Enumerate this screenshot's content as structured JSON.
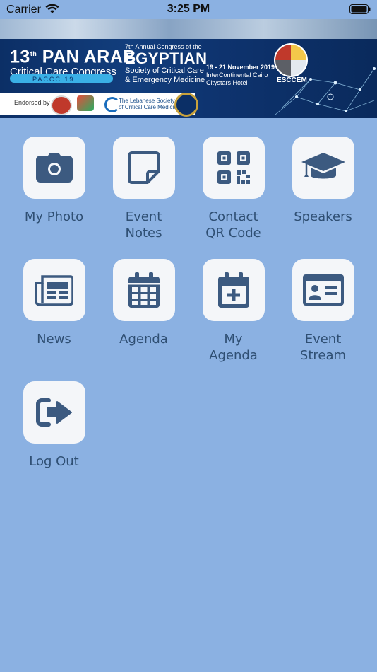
{
  "status": {
    "carrier": "Carrier",
    "time": "3:25 PM"
  },
  "banner": {
    "pan_number": "13",
    "pan_superscript": "th",
    "pan_title": "PAN ARAB",
    "pan_subtitle": "Critical Care Congress",
    "pacc": "PACCC 19",
    "egy_small": "7th Annual Congress of the",
    "egy_title": "EGYPTIAN",
    "egy_line1": "Society of Critical Care",
    "egy_line2": "& Emergency Medicine",
    "date": "19 - 21 November 2019",
    "venue1": "InterContinental Cairo",
    "venue2": "Citystars Hotel",
    "esccem": "ESCCEM",
    "endorsed": "Endorsed by",
    "lebanese1": "The Lebanese Society",
    "lebanese2": "of Critical Care Medicine"
  },
  "menu": [
    {
      "label": "My Photo",
      "icon": "camera-icon"
    },
    {
      "label": "Event\nNotes",
      "icon": "sticky-note-icon"
    },
    {
      "label": "Contact\nQR Code",
      "icon": "qr-code-icon"
    },
    {
      "label": "Speakers",
      "icon": "graduation-cap-icon"
    },
    {
      "label": "News",
      "icon": "newspaper-icon"
    },
    {
      "label": "Agenda",
      "icon": "calendar-icon"
    },
    {
      "label": "My\nAgenda",
      "icon": "calendar-plus-icon"
    },
    {
      "label": "Event\nStream",
      "icon": "id-card-icon"
    },
    {
      "label": "Log Out",
      "icon": "sign-out-icon"
    }
  ],
  "colors": {
    "background": "#8bb1e2",
    "tile": "#f4f6f9",
    "icon": "#3c5a80",
    "label": "#2f4f73"
  }
}
